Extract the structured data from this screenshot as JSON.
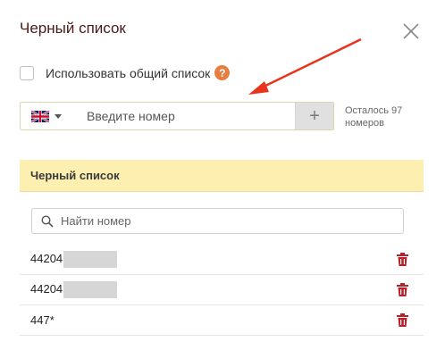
{
  "dialog": {
    "title": "Черный список"
  },
  "shared_list": {
    "label": "Использовать общий список",
    "checked": false,
    "help_glyph": "?"
  },
  "phone_input": {
    "country": "GB",
    "placeholder": "Введите номер",
    "add_glyph": "+"
  },
  "remaining": {
    "line1": "Осталось 97",
    "line2": "номеров"
  },
  "blacklist": {
    "header": "Черный список",
    "search_placeholder": "Найти номер",
    "items": [
      {
        "number": "44204",
        "redacted": true
      },
      {
        "number": "44204",
        "redacted": true
      },
      {
        "number": "447*",
        "redacted": false
      }
    ]
  },
  "colors": {
    "accent_arrow": "#e8341c",
    "header_bg": "#fcefb0",
    "trash": "#b8202a",
    "help": "#e67e40"
  },
  "icons": {
    "close": "close-icon",
    "flag": "uk-flag-icon",
    "search": "search-icon",
    "delete": "trash-icon"
  }
}
